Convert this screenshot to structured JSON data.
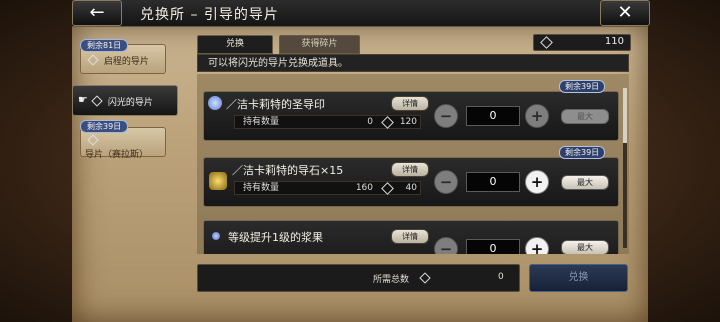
{
  "header": {
    "title": "兑换所 – 引导的导片",
    "back_icon": "back-arrow-icon",
    "close_icon": "close-icon"
  },
  "sidebar": {
    "items": [
      {
        "badge": "剩余81日",
        "label": "启程的导片",
        "active": false
      },
      {
        "badge": "",
        "label": "闪光的导片",
        "active": true
      },
      {
        "badge": "剩余39日",
        "label": "导片（赛拉斯）",
        "active": false
      }
    ]
  },
  "tabs": [
    {
      "label": "兑换",
      "active": true
    },
    {
      "label": "获得碎片",
      "active": false
    }
  ],
  "points": "110",
  "info": "可以将闪光的导片兑换成道具。",
  "items": [
    {
      "remain": "剩余39日",
      "name": "／洁卡莉特的圣导印",
      "detail": "详情",
      "held_label": "持有数量",
      "held": "0",
      "cost": "120",
      "qty": "0",
      "max": "最大",
      "enabled": false,
      "icon_color": "#6f8fd8"
    },
    {
      "remain": "剩余39日",
      "name": "／洁卡莉特的导石×15",
      "detail": "详情",
      "held_label": "持有数量",
      "held": "160",
      "cost": "40",
      "qty": "0",
      "max": "最大",
      "enabled": true,
      "icon_color": "#d8b040"
    },
    {
      "remain": "",
      "name": "等级提升1级的浆果",
      "detail": "详情",
      "held_label": "持有数量",
      "held": "",
      "cost": "",
      "qty": "0",
      "max": "最大",
      "enabled": true,
      "icon_color": "#7a8fe0"
    }
  ],
  "footer": {
    "total_label": "所需总数",
    "total_value": "0",
    "exchange_label": "兑换"
  }
}
